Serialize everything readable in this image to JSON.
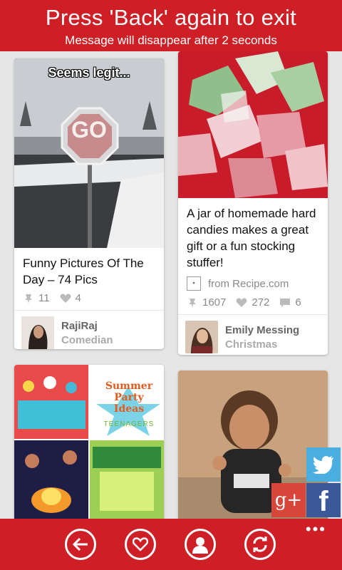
{
  "toast": {
    "title": "Press 'Back' again to exit",
    "subtitle": "Message will disappear after 2 seconds"
  },
  "cards": {
    "funny": {
      "image_caption": "Seems legit...",
      "sign_text": "GO",
      "title": "Funny Pictures Of The Day – 74 Pics",
      "repins": "11",
      "likes": "4",
      "user_name": "RajiRaj",
      "user_category": "Comedian"
    },
    "candy": {
      "title": "A jar of homemade hard candies makes a great gift or a fun stocking stuffer!",
      "source": "from Recipe.com",
      "repins": "1607",
      "likes": "272",
      "comments": "6",
      "user_name": "Emily Messing",
      "user_category": "Christmas"
    },
    "party": {
      "overlay_title": "Summer Party Ideas",
      "overlay_sub": "TEENAGERS"
    }
  },
  "social": {
    "twitter": "twitter-icon",
    "google_plus": "g+",
    "facebook": "f"
  },
  "appbar": {
    "more": "•••"
  },
  "colors": {
    "brand_red": "#cf1f26",
    "twitter": "#4aaee0",
    "gplus": "#d7453b",
    "facebook": "#3b5998"
  }
}
